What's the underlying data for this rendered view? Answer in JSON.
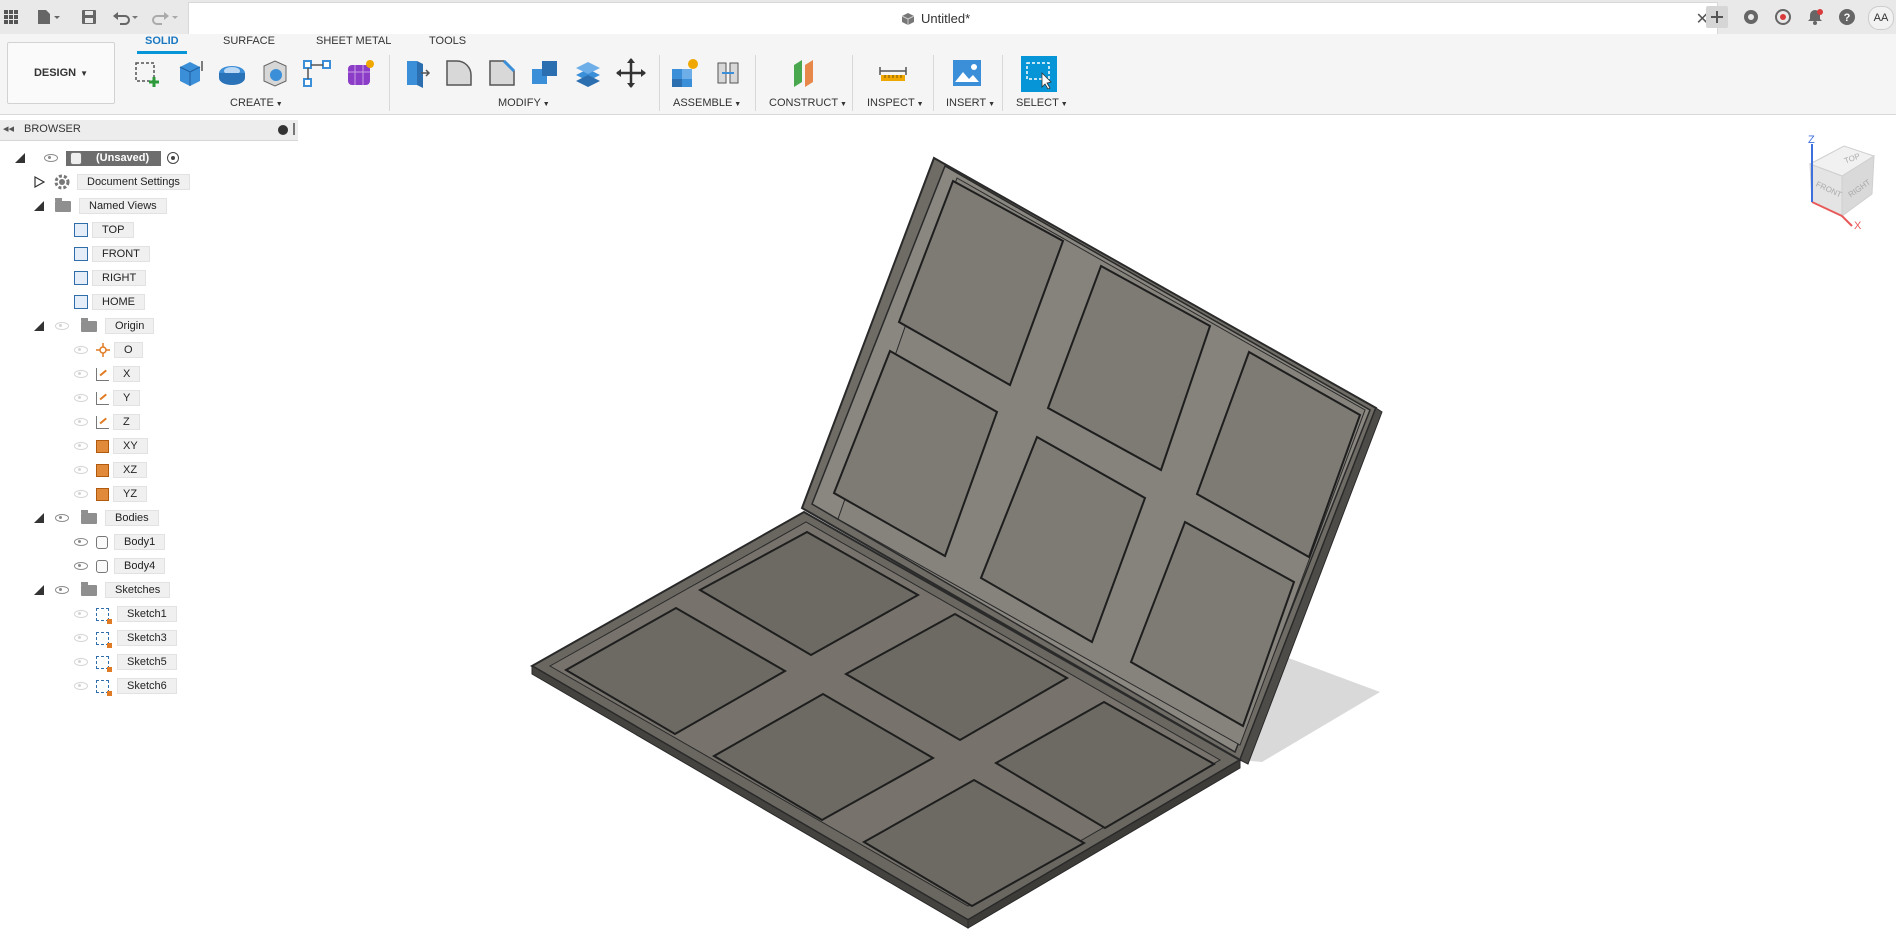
{
  "window": {
    "title": "Untitled*",
    "user_initials": "AA"
  },
  "workspace": {
    "label": "DESIGN"
  },
  "ribbon": {
    "tabs": [
      "SOLID",
      "SURFACE",
      "SHEET METAL",
      "TOOLS"
    ],
    "active_tab": "SOLID",
    "groups": [
      "CREATE",
      "MODIFY",
      "ASSEMBLE",
      "CONSTRUCT",
      "INSPECT",
      "INSERT",
      "SELECT"
    ]
  },
  "browser": {
    "title": "BROWSER",
    "root": "(Unsaved)",
    "document_settings": "Document Settings",
    "named_views": {
      "label": "Named Views",
      "items": [
        "TOP",
        "FRONT",
        "RIGHT",
        "HOME"
      ]
    },
    "origin": {
      "label": "Origin",
      "items": [
        "O",
        "X",
        "Y",
        "Z",
        "XY",
        "XZ",
        "YZ"
      ]
    },
    "bodies": {
      "label": "Bodies",
      "items": [
        "Body1",
        "Body4"
      ]
    },
    "sketches": {
      "label": "Sketches",
      "items": [
        "Sketch1",
        "Sketch3",
        "Sketch5",
        "Sketch6"
      ]
    }
  },
  "viewcube": {
    "top": "TOP",
    "front": "FRONT",
    "right": "RIGHT",
    "axis_z": "Z",
    "axis_x": "X"
  },
  "colors": {
    "accent": "#0696d7",
    "model": "#77746d",
    "model_edge": "#2a2a2a",
    "ui_bg": "#f5f5f5"
  }
}
